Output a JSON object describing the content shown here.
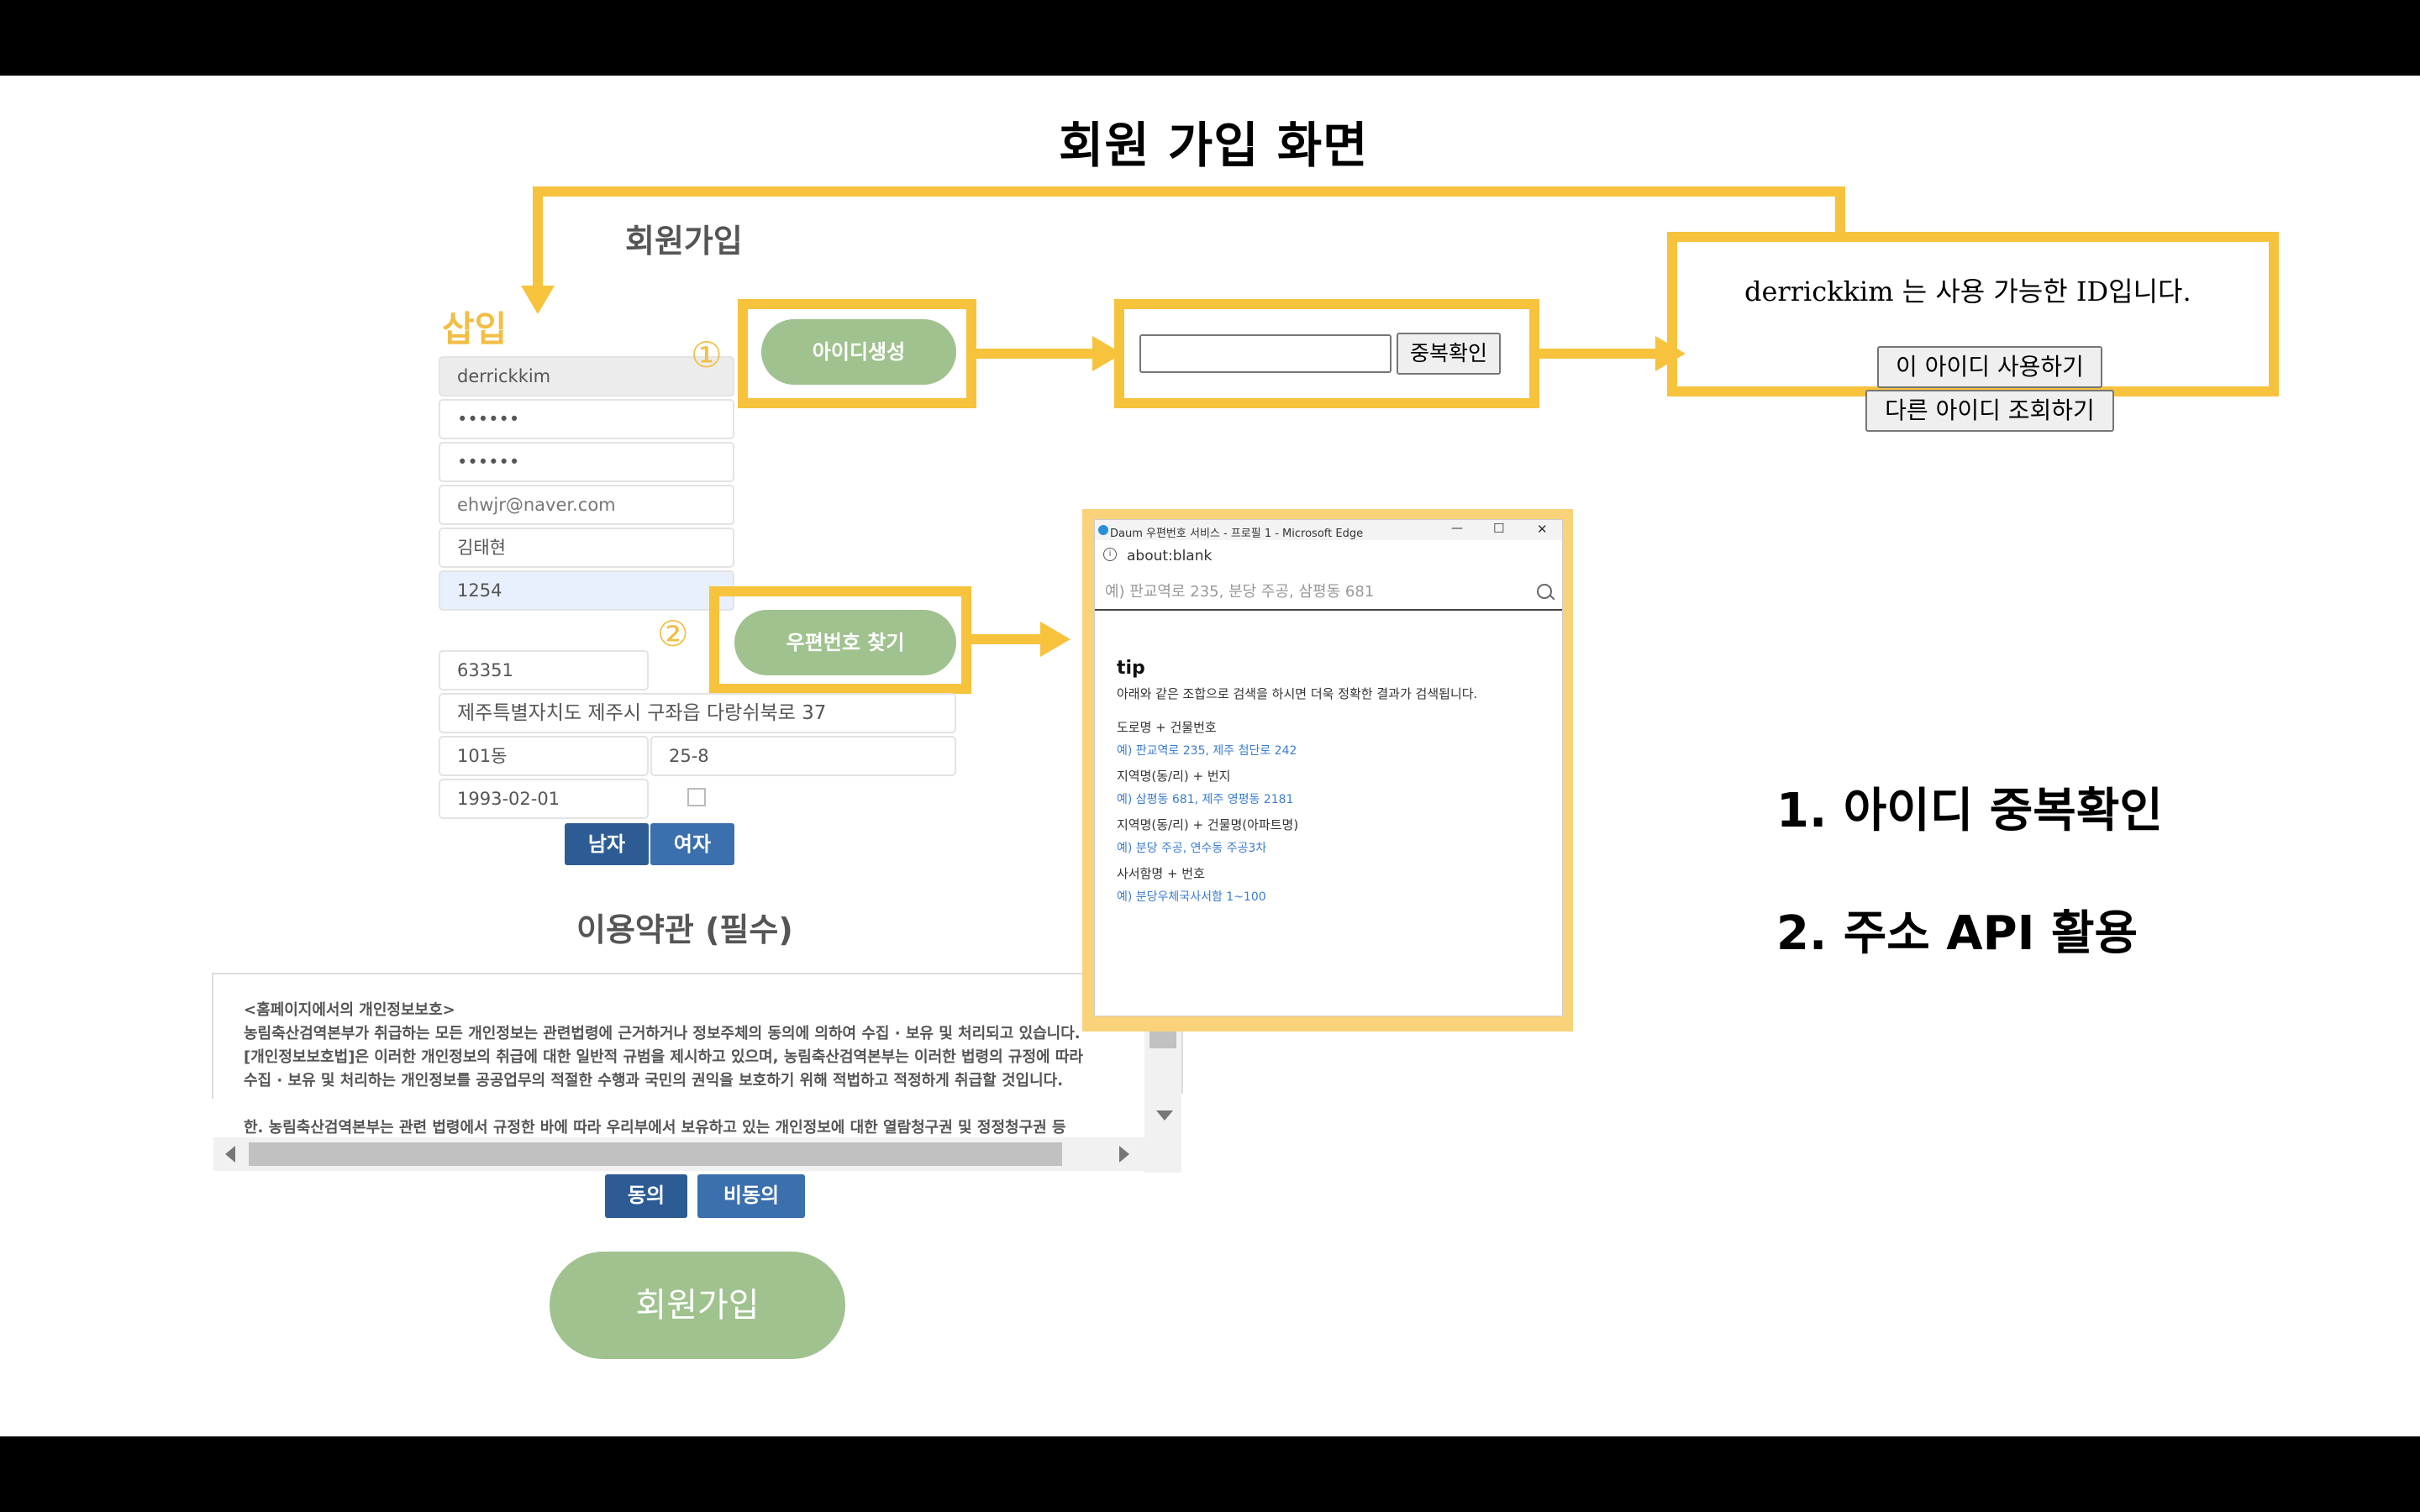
{
  "slide": {
    "title": "회원 가입 화면",
    "notes": [
      "1. 아이디 중복확인",
      "2. 주소 API 활용"
    ]
  },
  "form": {
    "title": "회원가입",
    "insert_label": "삽입",
    "step_marks": [
      "①",
      "②"
    ],
    "fields": {
      "id": "derrickkim",
      "password": "••••••",
      "password_confirm": "••••••",
      "email": "ehwjr@naver.com",
      "name": "김태현",
      "extra": "1254",
      "postcode": "63351",
      "address": "제주특별자치도 제주시 구좌읍 다랑쉬북로 37",
      "address_detail1": "101동",
      "address_detail2": "25-8",
      "birth": "1993-02-01"
    },
    "id_gen_button": "아이디생성",
    "zip_button": "우편번호 찾기",
    "gender": [
      "남자",
      "여자"
    ],
    "terms_title": "이용약관 (필수)",
    "terms_lines": [
      "<홈페이지에서의 개인정보보호>",
      "농림축산검역본부가 취급하는 모든 개인정보는 관련법령에 근거하거나 정보주체의 동의에 의하여 수집 · 보유 및 처리되고 있습니다.",
      "[개인정보보호법]은 이러한 개인정보의 취급에 대한 일반적 규범을 제시하고 있으며, 농림축산검역본부는 이러한 법령의 규정에 따라",
      "수집 · 보유 및 처리하는 개인정보를 공공업무의 적절한 수행과 국민의 권익을 보호하기 위해 적법하고 적정하게 취급할 것입니다.",
      "",
      "한. 농림축산검역본부는 관련 법령에서 규정한 바에 따라 우리부에서 보유하고 있는 개인정보에 대한 열람청구권 및 정정청구권 등"
    ],
    "agree": "동의",
    "disagree": "비동의",
    "submit": "회원가입"
  },
  "dup_check": {
    "input_value": "",
    "button": "중복확인"
  },
  "dup_result": {
    "message": "derrickkim 는 사용 가능한 ID입니다.",
    "use_button": "이 아이디 사용하기",
    "other_button": "다른 아이디 조회하기"
  },
  "popup": {
    "window_title": "Daum 우편번호 서비스 - 프로필 1 - Microsoft Edge",
    "url": "about:blank",
    "search_placeholder": "예) 판교역로 235, 분당 주공, 삼평동 681",
    "tip_title": "tip",
    "tip_desc": "아래와 같은 조합으로 검색을 하시면 더욱 정확한 결과가 검색됩니다.",
    "tips": [
      {
        "label": "도로명 + 건물번호",
        "example": "예) 판교역로 235,  제주 첨단로 242"
      },
      {
        "label": "지역명(동/리) + 번지",
        "example": "예) 삼평동 681,  제주 영평동 2181"
      },
      {
        "label": "지역명(동/리) + 건물명(아파트명)",
        "example": "예) 분당 주공,  연수동 주공3차"
      },
      {
        "label": "사서함명 + 번호",
        "example": "예) 분당우체국사서함 1~100"
      }
    ],
    "controls": [
      "—",
      "☐",
      "✕"
    ]
  },
  "colors": {
    "accent_yellow": "#f7c23c",
    "pill_green": "#9fc28f",
    "button_blue": "#3b6fad"
  }
}
